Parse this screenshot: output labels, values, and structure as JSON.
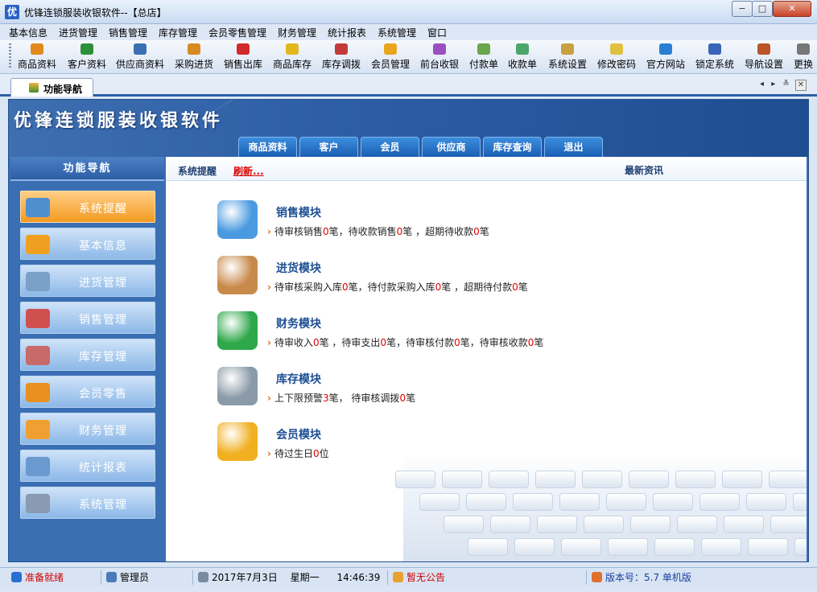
{
  "window": {
    "title": "优锋连锁服装收银软件--【总店】",
    "icon_char": "优",
    "controls": {
      "minimize": "−",
      "maximize": "□",
      "close": "✕"
    }
  },
  "menu": [
    "基本信息",
    "进货管理",
    "销售管理",
    "库存管理",
    "会员零售管理",
    "财务管理",
    "统计报表",
    "系统管理",
    "窗口"
  ],
  "toolbar": [
    {
      "label": "商品资料",
      "icon": "product-icon",
      "color": "#e08a1e"
    },
    {
      "label": "客户资料",
      "icon": "customer-icon",
      "color": "#2e8f3a"
    },
    {
      "label": "供应商资料",
      "icon": "supplier-icon",
      "color": "#3a6fb4"
    },
    {
      "label": "采购进货",
      "icon": "truck-icon",
      "color": "#d68a22"
    },
    {
      "label": "销售出库",
      "icon": "sales-icon",
      "color": "#d12a2a"
    },
    {
      "label": "商品库存",
      "icon": "stock-icon",
      "color": "#e0b81e"
    },
    {
      "label": "库存调拨",
      "icon": "transfer-icon",
      "color": "#c23a3a"
    },
    {
      "label": "会员管理",
      "icon": "member-icon",
      "color": "#e8a51e"
    },
    {
      "label": "前台收银",
      "icon": "cashier-icon",
      "color": "#9a4fc2"
    },
    {
      "label": "付款单",
      "icon": "payment-icon",
      "color": "#6aa64a"
    },
    {
      "label": "收款单",
      "icon": "receipt-icon",
      "color": "#4aa66a"
    },
    {
      "label": "系统设置",
      "icon": "settings-icon",
      "color": "#c8a040"
    },
    {
      "label": "修改密码",
      "icon": "password-icon",
      "color": "#e0c040"
    },
    {
      "label": "官方网站",
      "icon": "website-icon",
      "color": "#2a7fd4"
    },
    {
      "label": "锁定系统",
      "icon": "lock-icon",
      "color": "#3a64b8"
    },
    {
      "label": "导航设置",
      "icon": "nav-settings-icon",
      "color": "#b8562a"
    },
    {
      "label": "更换",
      "icon": "switch-icon",
      "color": "#777777"
    }
  ],
  "tab": {
    "label": "功能导航",
    "arrows": "◂ ▸ ≚"
  },
  "banner": {
    "heading": "优锋连锁服装收银软件",
    "tabs": [
      "商品资料",
      "客户",
      "会员",
      "供应商",
      "库存查询",
      "退出"
    ]
  },
  "sidebar": {
    "title": "功能导航",
    "items": [
      {
        "label": "系统提醒",
        "icon": "reminder-icon",
        "active": true,
        "color": "#4f8fd0"
      },
      {
        "label": "基本信息",
        "icon": "basic-info-icon",
        "active": false,
        "color": "#f0a020"
      },
      {
        "label": "进货管理",
        "icon": "cart-purchase-icon",
        "active": false,
        "color": "#7aa0c8"
      },
      {
        "label": "销售管理",
        "icon": "cart-sales-icon",
        "active": false,
        "color": "#d05050"
      },
      {
        "label": "库存管理",
        "icon": "warehouse-icon",
        "active": false,
        "color": "#c86a6a"
      },
      {
        "label": "会员零售",
        "icon": "member-retail-icon",
        "active": false,
        "color": "#e89020"
      },
      {
        "label": "财务管理",
        "icon": "finance-icon",
        "active": false,
        "color": "#f0a030"
      },
      {
        "label": "统计报表",
        "icon": "report-icon",
        "active": false,
        "color": "#6a9ad0"
      },
      {
        "label": "系统管理",
        "icon": "gears-icon",
        "active": false,
        "color": "#8a9ab0"
      }
    ]
  },
  "content": {
    "reminder_label": "系统提醒",
    "refresh_label": "刷新...",
    "news_label": "最新资讯",
    "modules": [
      {
        "title": "销售模块",
        "icon": "book-icon",
        "color": "#4a9ae0",
        "line": [
          [
            "待审核销售",
            "0",
            "笔，待收款销售"
          ],
          [
            "",
            "0",
            "笔 ，超期待收款"
          ],
          [
            "",
            "0",
            "笔"
          ]
        ]
      },
      {
        "title": "进货模块",
        "icon": "box-icon",
        "color": "#c88a4a",
        "line": [
          [
            "待审核采购入库",
            "0",
            "笔，待付款采购入库"
          ],
          [
            "",
            "0",
            "笔 ，超期待付款"
          ],
          [
            "",
            "0",
            "笔"
          ]
        ]
      },
      {
        "title": "财务模块",
        "icon": "money-icon",
        "color": "#2ea84a",
        "line": [
          [
            "待审收入",
            "0",
            "笔 ，待审支出"
          ],
          [
            "",
            "0",
            "笔，待审核付款"
          ],
          [
            "",
            "0",
            "笔，待审核收款"
          ],
          [
            "",
            "0",
            "笔"
          ]
        ]
      },
      {
        "title": "库存模块",
        "icon": "database-icon",
        "color": "#8a9aa8",
        "line": [
          [
            "上下限预警",
            "3",
            "笔，  待审核调拨"
          ],
          [
            "",
            "0",
            "笔"
          ]
        ]
      },
      {
        "title": "会员模块",
        "icon": "chat-icon",
        "color": "#f0b020",
        "line": [
          [
            "待过生日",
            "0",
            "位"
          ]
        ]
      }
    ]
  },
  "status": {
    "ready": "准备就绪",
    "user": "管理员",
    "date": "2017年7月3日",
    "weekday": "星期一",
    "time": "14:46:39",
    "notice": "暂无公告",
    "version": "版本号：5.7  单机版"
  }
}
